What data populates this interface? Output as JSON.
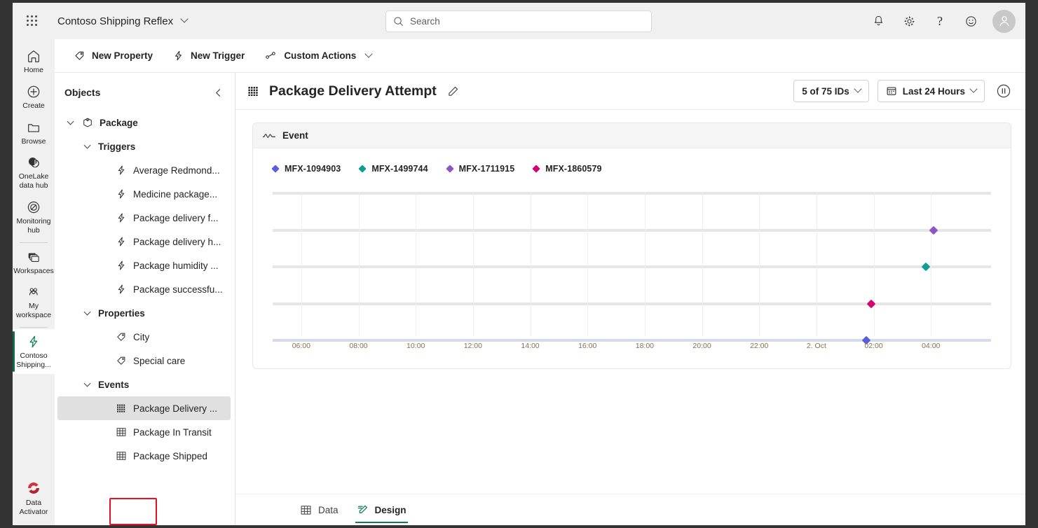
{
  "topbar": {
    "waffle_icon": "app-launcher-icon",
    "app_title": "Contoso Shipping Reflex",
    "search": {
      "placeholder": "Search",
      "icon": "search-icon"
    },
    "icons": [
      {
        "name": "notifications-icon",
        "glyph": "bell"
      },
      {
        "name": "settings-icon",
        "glyph": "gear"
      },
      {
        "name": "help-icon",
        "glyph": "question"
      },
      {
        "name": "feedback-icon",
        "glyph": "smiley"
      }
    ],
    "avatar": "user-avatar"
  },
  "rail": {
    "items": [
      {
        "label": "Home",
        "icon": "home-icon",
        "active": false
      },
      {
        "label": "Create",
        "icon": "plus-circle-icon",
        "active": false
      },
      {
        "label": "Browse",
        "icon": "folder-icon",
        "active": false
      },
      {
        "label": "OneLake data hub",
        "icon": "onelake-icon",
        "active": false
      },
      {
        "label": "Monitoring hub",
        "icon": "monitoring-icon",
        "active": false
      },
      {
        "label": "Workspaces",
        "icon": "workspaces-icon",
        "active": false
      },
      {
        "label": "My workspace",
        "icon": "my-workspace-icon",
        "active": false
      },
      {
        "label": "Contoso Shipping...",
        "icon": "reflex-bolt-icon",
        "active": true
      }
    ],
    "bottom_item": {
      "label": "Data Activator",
      "icon": "data-activator-icon"
    }
  },
  "commandbar": {
    "items": [
      {
        "label": "New Property",
        "icon": "tag-icon",
        "has_chevron": false
      },
      {
        "label": "New Trigger",
        "icon": "bolt-icon",
        "has_chevron": false
      },
      {
        "label": "Custom Actions",
        "icon": "custom-actions-icon",
        "has_chevron": true
      }
    ]
  },
  "objects_panel": {
    "title": "Objects",
    "collapse_icon": "chevron-left-icon",
    "tree": [
      {
        "label": "Package",
        "icon": "package-icon",
        "indent": 1,
        "twisty": true,
        "bold": true,
        "selected": false
      },
      {
        "label": "Triggers",
        "icon": "",
        "indent": 2,
        "twisty": true,
        "bold": true,
        "selected": false
      },
      {
        "label": "Average Redmond...",
        "icon": "bolt-icon",
        "indent": 3,
        "twisty": false,
        "bold": false,
        "selected": false
      },
      {
        "label": "Medicine package...",
        "icon": "bolt-icon",
        "indent": 3,
        "twisty": false,
        "bold": false,
        "selected": false
      },
      {
        "label": "Package delivery f...",
        "icon": "bolt-icon",
        "indent": 3,
        "twisty": false,
        "bold": false,
        "selected": false
      },
      {
        "label": "Package delivery h...",
        "icon": "bolt-icon",
        "indent": 3,
        "twisty": false,
        "bold": false,
        "selected": false
      },
      {
        "label": "Package humidity ...",
        "icon": "bolt-icon",
        "indent": 3,
        "twisty": false,
        "bold": false,
        "selected": false
      },
      {
        "label": "Package successfu...",
        "icon": "bolt-icon",
        "indent": 3,
        "twisty": false,
        "bold": false,
        "selected": false
      },
      {
        "label": "Properties",
        "icon": "",
        "indent": 2,
        "twisty": true,
        "bold": true,
        "selected": false
      },
      {
        "label": "City",
        "icon": "tag-icon",
        "indent": 3,
        "twisty": false,
        "bold": false,
        "selected": false
      },
      {
        "label": "Special care",
        "icon": "tag-icon",
        "indent": 3,
        "twisty": false,
        "bold": false,
        "selected": false
      },
      {
        "label": "Events",
        "icon": "",
        "indent": 2,
        "twisty": true,
        "bold": true,
        "selected": false
      },
      {
        "label": "Package Delivery ...",
        "icon": "event-grid-icon",
        "indent": 3,
        "twisty": false,
        "bold": false,
        "selected": true
      },
      {
        "label": "Package In Transit",
        "icon": "table-icon",
        "indent": 3,
        "twisty": false,
        "bold": false,
        "selected": false
      },
      {
        "label": "Package Shipped",
        "icon": "table-icon",
        "indent": 3,
        "twisty": false,
        "bold": false,
        "selected": false
      }
    ]
  },
  "canvas_header": {
    "icon": "event-grid-icon",
    "title": "Package Delivery Attempt",
    "edit_icon": "pencil-icon",
    "id_filter": {
      "label": "5 of 75 IDs",
      "icon": ""
    },
    "time_filter": {
      "label": "Last 24 Hours",
      "icon": "calendar-icon"
    },
    "pause_button": "pause-icon"
  },
  "card": {
    "header_icon": "line-chart-icon",
    "header_label": "Event"
  },
  "chart_data": {
    "type": "scatter",
    "title": "Event",
    "xlabel": "",
    "ylabel": "",
    "grid": true,
    "legend_position": "top-left",
    "x_ticks": [
      "06:00",
      "08:00",
      "10:00",
      "12:00",
      "14:00",
      "16:00",
      "18:00",
      "20:00",
      "22:00",
      "2. Oct",
      "02:00",
      "04:00"
    ],
    "y_gridlines": [
      1,
      2,
      3,
      4,
      5
    ],
    "series": [
      {
        "name": "MFX-1094903",
        "color": "#5b5fd6",
        "points": [
          {
            "x": "01:45",
            "y": 1
          }
        ]
      },
      {
        "name": "MFX-1499744",
        "color": "#0e9c94",
        "points": [
          {
            "x": "03:50",
            "y": 3
          }
        ]
      },
      {
        "name": "MFX-1711915",
        "color": "#8b55c4",
        "points": [
          {
            "x": "04:05",
            "y": 4
          }
        ]
      },
      {
        "name": "MFX-1860579",
        "color": "#d4006f",
        "points": [
          {
            "x": "01:55",
            "y": 2
          }
        ]
      }
    ]
  },
  "bottom_tabs": {
    "tabs": [
      {
        "label": "Data",
        "icon": "table-icon",
        "active": false,
        "highlighted": false
      },
      {
        "label": "Design",
        "icon": "design-pen-icon",
        "active": true,
        "highlighted": true
      }
    ]
  },
  "colors": {
    "accent_green": "#0f7b5c",
    "highlight_red": "#e81123",
    "chrome_gray": "#f0f0f0"
  }
}
